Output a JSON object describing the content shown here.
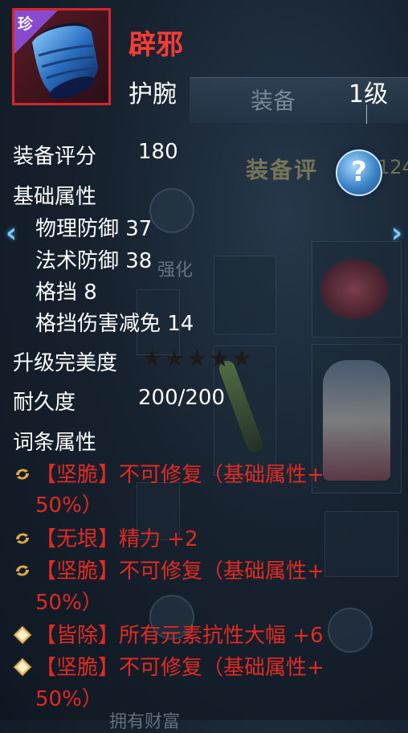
{
  "item": {
    "rarity_label": "珍",
    "name": "辟邪",
    "type": "护腕",
    "level": "1级",
    "colors": {
      "name": "#ff3b33",
      "frame": "#d4262c",
      "affix": "#e22a22"
    }
  },
  "background": {
    "tab_label": "装备",
    "subtitle": "装备评",
    "subtitle_num": "124",
    "strengthen_label": "强化",
    "bottom_label": "拥有财富"
  },
  "stats": {
    "score_label": "装备评分",
    "score_value": "180",
    "base_label": "基础属性",
    "base_items": [
      "物理防御 37",
      "法术防御 38",
      "格挡 8",
      "格挡伤害减免 14"
    ],
    "perfection_label": "升级完美度",
    "perfection_stars": 0,
    "perfection_max": 5,
    "durability_label": "耐久度",
    "durability_value": "200/200",
    "affix_label": "词条属性"
  },
  "affixes": [
    {
      "icon": "swirl-icon",
      "line1": "【坚脆】不可修复（基础属性+",
      "line2": "50%）"
    },
    {
      "icon": "swirl-icon",
      "line1": "【无垠】精力 +2",
      "line2": ""
    },
    {
      "icon": "swirl-icon",
      "line1": "【坚脆】不可修复（基础属性+",
      "line2": "50%）"
    },
    {
      "icon": "diamond-icon",
      "line1": "【皆除】所有元素抗性大幅 +6",
      "line2": ""
    },
    {
      "icon": "diamond-icon",
      "line1": "【坚脆】不可修复（基础属性+",
      "line2": "50%）"
    }
  ],
  "icons": {
    "help": "?",
    "left_arrow": "‹",
    "right_arrow": "›"
  }
}
